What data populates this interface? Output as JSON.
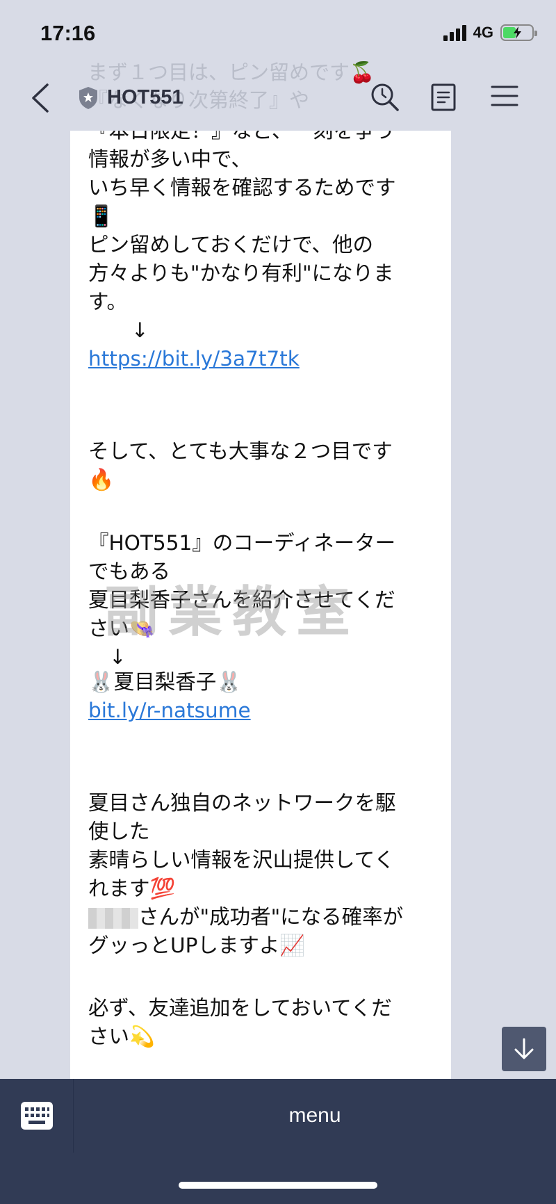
{
  "status_bar": {
    "time": "17:16",
    "network": "4G"
  },
  "background_text": {
    "lines": [
      "まず１つ目は、ピン留めです🍒",
      "『なくなり次第終了』や"
    ]
  },
  "header": {
    "title": "HOT551"
  },
  "message": {
    "lines": [
      "『本日限定！』など、一刻を争う",
      "情報が多い中で、",
      "いち早く情報を確認するためです",
      "📱",
      "ピン留めしておくだけで、他の",
      "方々よりも\"かなり有利\"になりま",
      "す。",
      "↓",
      "https://bit.ly/3a7t7tk",
      "",
      "",
      "そして、とても大事な２つ目です",
      "🔥",
      "",
      "『HOT551』のコーディネーター",
      "でもある",
      "夏目梨香子さんを紹介させてくだ",
      "さい👒",
      "↓",
      "🐰夏目梨香子🐰",
      "bit.ly/r-natsume",
      "",
      "",
      "夏目さん独自のネットワークを駆",
      "使した",
      "素晴らしい情報を沢山提供してく",
      "れます💯",
      "さんが\"成功者\"になる確率が",
      "グッっとUPしますよ📈",
      "",
      "必ず、友達追加をしておいてくだ",
      "さい💫"
    ]
  },
  "watermark": {
    "text": "副業教室"
  },
  "bottom_bar": {
    "menu_label": "menu"
  },
  "colors": {
    "background": "#d8dbe6",
    "bubble": "#ffffff",
    "link": "#2a78d8",
    "bottom_bar": "#313b55"
  }
}
